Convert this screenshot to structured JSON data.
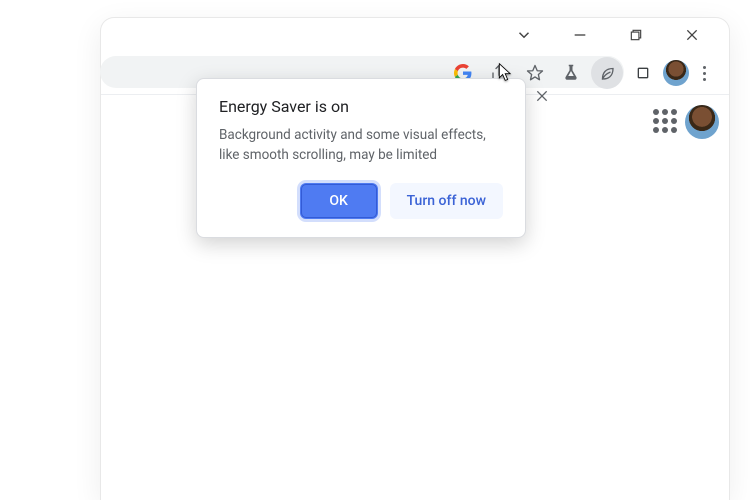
{
  "window_controls": {
    "tab_dropdown": "tab-dropdown-icon",
    "minimize": "minimize-icon",
    "maximize": "maximize-icon",
    "close": "close-icon"
  },
  "toolbar": {
    "google_icon": "google-logo-icon",
    "share_icon": "share-icon",
    "bookmark_icon": "star-icon",
    "labs_icon": "flask-icon",
    "energy_saver_icon": "leaf-icon",
    "extensions_icon": "extensions-icon",
    "profile_avatar": "avatar-icon",
    "overflow_menu": "kebab-menu"
  },
  "popover": {
    "title": "Energy Saver is on",
    "body": "Background activity and some visual effects, like smooth scrolling, may be limited",
    "primary_btn": "OK",
    "secondary_btn": "Turn off now"
  },
  "new_tab_page": {
    "apps_grid_icon": "apps-grid-icon"
  },
  "colors": {
    "primary": "#4f7bf2"
  }
}
